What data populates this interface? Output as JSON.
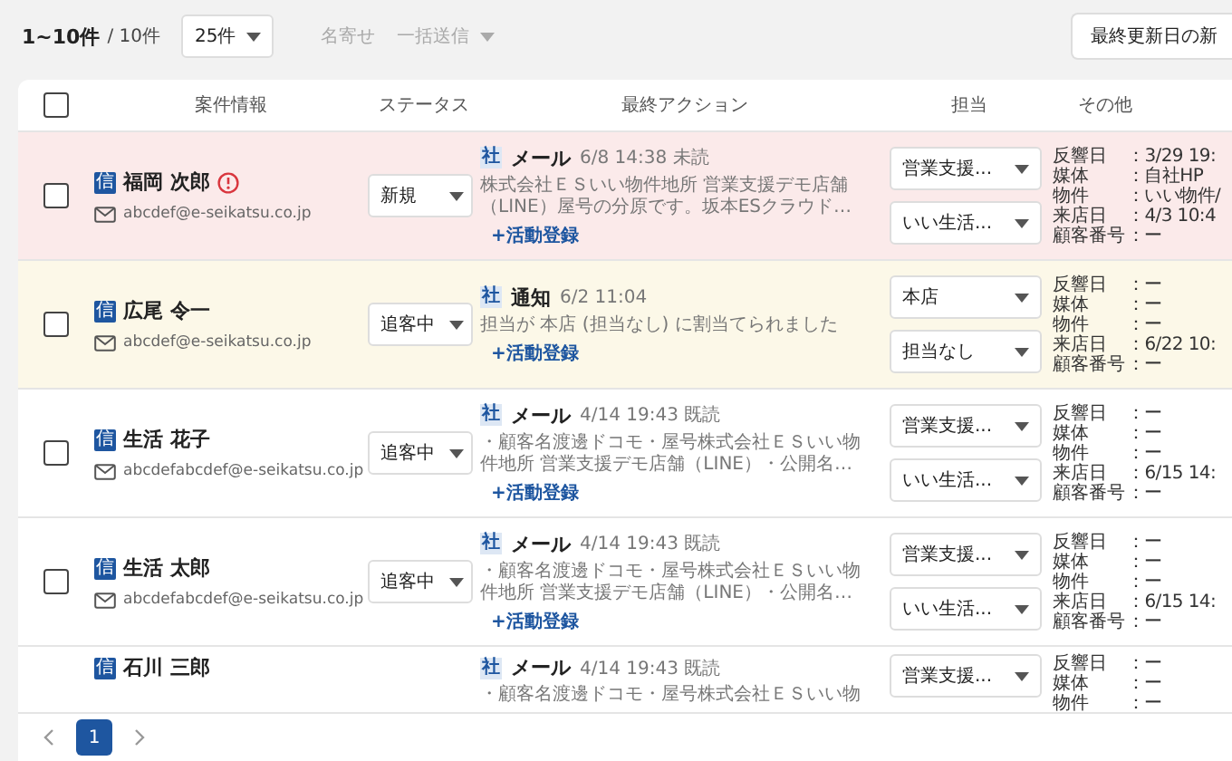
{
  "toolbar": {
    "range": "1~10件",
    "total": "/ 10件",
    "page_size": "25件",
    "actions": [
      {
        "label": "名寄せ",
        "disabled": true,
        "dropdown": false
      },
      {
        "label": "一括送信",
        "disabled": true,
        "dropdown": true
      }
    ],
    "sort_button": "最終更新日の新"
  },
  "table": {
    "select_all_checked": false,
    "columns": [
      "案件情報",
      "ステータス",
      "最終アクション",
      "担当",
      "その他"
    ],
    "rows": [
      {
        "color": "#fbeaea",
        "checked": false,
        "badge": "信",
        "name": "福岡 次郎",
        "warning": true,
        "email": "abcdef@e-seikatsu.co.jp",
        "status": "新規",
        "action": {
          "badge": "社",
          "type": "メール",
          "time": "6/8 14:38 未読",
          "message": "株式会社ＥＳいい物件地所 営業支援デモ店舗（LINE）屋号の分原です。坂本ESクラウド…",
          "link": "+活動登録"
        },
        "assignees": [
          "営業支援...",
          "いい生活..."
        ],
        "details": [
          {
            "label": "反響日",
            "value": "：3/29 19:"
          },
          {
            "label": "媒体",
            "value": "：自社HP"
          },
          {
            "label": "物件",
            "value": "：いい物件/"
          },
          {
            "label": "来店日",
            "value": "：4/3 10:4"
          },
          {
            "label": "顧客番号",
            "value": "：ー"
          }
        ]
      },
      {
        "color": "#fcf8e8",
        "checked": false,
        "badge": "信",
        "name": "広尾 令一",
        "warning": false,
        "email": "abcdef@e-seikatsu.co.jp",
        "status": "追客中",
        "action": {
          "badge": "社",
          "type": "通知",
          "time": "6/2 11:04",
          "message": "担当が 本店 (担当なし) に割当てられました",
          "link": "+活動登録"
        },
        "assignees": [
          "本店",
          "担当なし"
        ],
        "details": [
          {
            "label": "反響日",
            "value": "：ー"
          },
          {
            "label": "媒体",
            "value": "：ー"
          },
          {
            "label": "物件",
            "value": "：ー"
          },
          {
            "label": "来店日",
            "value": "：6/22 10:"
          },
          {
            "label": "顧客番号",
            "value": "：ー"
          }
        ]
      },
      {
        "color": "#ffffff",
        "checked": false,
        "badge": "信",
        "name": "生活 花子",
        "warning": false,
        "email": "abcdefabcdef@e-seikatsu.co.jp",
        "status": "追客中",
        "action": {
          "badge": "社",
          "type": "メール",
          "time": "4/14 19:43 既読",
          "message": "・顧客名渡邊ドコモ・屋号株式会社ＥＳいい物件地所 営業支援デモ店舗（LINE）・公開名…",
          "link": "+活動登録"
        },
        "assignees": [
          "営業支援...",
          "いい生活..."
        ],
        "details": [
          {
            "label": "反響日",
            "value": "：ー"
          },
          {
            "label": "媒体",
            "value": "：ー"
          },
          {
            "label": "物件",
            "value": "：ー"
          },
          {
            "label": "来店日",
            "value": "：6/15 14:"
          },
          {
            "label": "顧客番号",
            "value": "：ー"
          }
        ]
      },
      {
        "color": "#ffffff",
        "checked": false,
        "badge": "信",
        "name": "生活 太郎",
        "warning": false,
        "email": "abcdefabcdef@e-seikatsu.co.jp",
        "status": "追客中",
        "action": {
          "badge": "社",
          "type": "メール",
          "time": "4/14 19:43 既読",
          "message": "・顧客名渡邊ドコモ・屋号株式会社ＥＳいい物件地所 営業支援デモ店舗（LINE）・公開名…",
          "link": "+活動登録"
        },
        "assignees": [
          "営業支援...",
          "いい生活..."
        ],
        "details": [
          {
            "label": "反響日",
            "value": "：ー"
          },
          {
            "label": "媒体",
            "value": "：ー"
          },
          {
            "label": "物件",
            "value": "：ー"
          },
          {
            "label": "来店日",
            "value": "：6/15 14:"
          },
          {
            "label": "顧客番号",
            "value": "：ー"
          }
        ]
      },
      {
        "color": "#ffffff",
        "badge": "信",
        "name": "石川 三郎",
        "warning": false,
        "action": {
          "badge": "社",
          "type": "メール",
          "time": "4/14 19:43 既読",
          "message": "・顧客名渡邊ドコモ・屋号株式会社ＥＳいい物"
        },
        "assignees": [
          "営業支援..."
        ],
        "details": [
          {
            "label": "反響日",
            "value": "：ー"
          },
          {
            "label": "媒体",
            "value": "：ー"
          },
          {
            "label": "物件",
            "value": "：ー"
          }
        ]
      }
    ]
  },
  "pagination": {
    "pages": [
      {
        "label": "1",
        "selected": true
      }
    ]
  }
}
